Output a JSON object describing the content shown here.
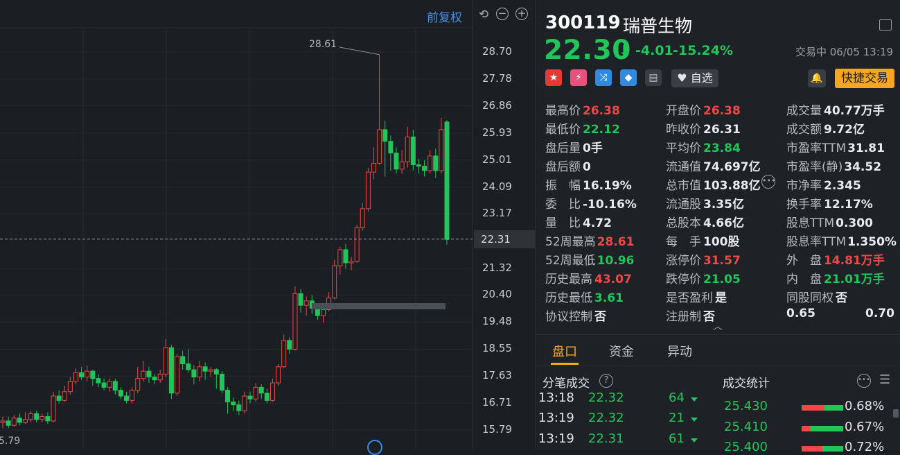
{
  "chart": {
    "restore_label": "前复权",
    "high_marker": "28.61",
    "low_marker": "5.79",
    "current_price_tag": "22.31",
    "y_ticks": [
      "28.70",
      "27.78",
      "26.86",
      "25.93",
      "25.01",
      "24.09",
      "23.17",
      "21.32",
      "20.40",
      "19.48",
      "18.55",
      "17.63",
      "16.71",
      "15.79"
    ],
    "up_color": "#f04848",
    "down_color": "#21c55a",
    "candles": [
      {
        "o": 16.05,
        "c": 16.1,
        "h": 16.25,
        "l": 15.85
      },
      {
        "o": 16.1,
        "c": 15.95,
        "h": 16.25,
        "l": 15.85
      },
      {
        "o": 15.95,
        "c": 16.2,
        "h": 16.3,
        "l": 15.9
      },
      {
        "o": 16.2,
        "c": 16.05,
        "h": 16.35,
        "l": 15.95
      },
      {
        "o": 16.05,
        "c": 16.15,
        "h": 16.4,
        "l": 16.0
      },
      {
        "o": 16.15,
        "c": 16.35,
        "h": 16.45,
        "l": 16.05
      },
      {
        "o": 16.35,
        "c": 16.15,
        "h": 16.45,
        "l": 16.05
      },
      {
        "o": 16.15,
        "c": 16.25,
        "h": 16.35,
        "l": 16.05
      },
      {
        "o": 16.25,
        "c": 16.1,
        "h": 16.4,
        "l": 16.0
      },
      {
        "o": 16.1,
        "c": 16.95,
        "h": 17.1,
        "l": 16.05
      },
      {
        "o": 16.95,
        "c": 16.8,
        "h": 17.15,
        "l": 16.7
      },
      {
        "o": 16.8,
        "c": 17.1,
        "h": 17.3,
        "l": 16.75
      },
      {
        "o": 17.1,
        "c": 17.45,
        "h": 17.6,
        "l": 17.0
      },
      {
        "o": 17.45,
        "c": 17.75,
        "h": 17.9,
        "l": 17.35
      },
      {
        "o": 17.75,
        "c": 17.6,
        "h": 17.95,
        "l": 17.5
      },
      {
        "o": 17.6,
        "c": 17.8,
        "h": 18.0,
        "l": 17.45
      },
      {
        "o": 17.8,
        "c": 17.55,
        "h": 17.85,
        "l": 17.3
      },
      {
        "o": 17.55,
        "c": 17.4,
        "h": 17.7,
        "l": 17.25
      },
      {
        "o": 17.4,
        "c": 17.25,
        "h": 17.55,
        "l": 17.15
      },
      {
        "o": 17.25,
        "c": 17.45,
        "h": 17.55,
        "l": 17.1
      },
      {
        "o": 17.45,
        "c": 17.15,
        "h": 17.55,
        "l": 17.0
      },
      {
        "o": 17.15,
        "c": 16.95,
        "h": 17.25,
        "l": 16.85
      },
      {
        "o": 16.95,
        "c": 16.8,
        "h": 17.1,
        "l": 16.7
      },
      {
        "o": 16.8,
        "c": 17.15,
        "h": 17.25,
        "l": 16.7
      },
      {
        "o": 17.15,
        "c": 17.55,
        "h": 17.95,
        "l": 17.05
      },
      {
        "o": 17.55,
        "c": 17.8,
        "h": 18.15,
        "l": 17.45
      },
      {
        "o": 17.8,
        "c": 17.6,
        "h": 17.95,
        "l": 17.4
      },
      {
        "o": 17.6,
        "c": 17.5,
        "h": 17.7,
        "l": 17.35
      },
      {
        "o": 17.5,
        "c": 17.7,
        "h": 17.85,
        "l": 17.4
      },
      {
        "o": 17.7,
        "c": 18.6,
        "h": 18.9,
        "l": 17.6
      },
      {
        "o": 18.6,
        "c": 17.05,
        "h": 18.7,
        "l": 16.85
      },
      {
        "o": 17.05,
        "c": 18.3,
        "h": 18.4,
        "l": 16.95
      },
      {
        "o": 18.3,
        "c": 18.05,
        "h": 18.5,
        "l": 17.85
      },
      {
        "o": 18.05,
        "c": 17.85,
        "h": 18.55,
        "l": 17.75
      },
      {
        "o": 17.85,
        "c": 17.6,
        "h": 18.0,
        "l": 17.35
      },
      {
        "o": 17.6,
        "c": 17.95,
        "h": 18.15,
        "l": 17.45
      },
      {
        "o": 17.95,
        "c": 17.8,
        "h": 18.1,
        "l": 17.5
      },
      {
        "o": 17.8,
        "c": 17.85,
        "h": 17.95,
        "l": 17.6
      },
      {
        "o": 17.85,
        "c": 17.7,
        "h": 17.9,
        "l": 17.2
      },
      {
        "o": 17.7,
        "c": 17.15,
        "h": 17.8,
        "l": 17.05
      },
      {
        "o": 17.15,
        "c": 16.75,
        "h": 17.25,
        "l": 16.35
      },
      {
        "o": 16.75,
        "c": 16.65,
        "h": 16.9,
        "l": 16.45
      },
      {
        "o": 16.65,
        "c": 16.45,
        "h": 16.8,
        "l": 16.3
      },
      {
        "o": 16.45,
        "c": 16.95,
        "h": 17.1,
        "l": 16.35
      },
      {
        "o": 16.95,
        "c": 16.85,
        "h": 17.1,
        "l": 16.7
      },
      {
        "o": 16.85,
        "c": 17.25,
        "h": 17.4,
        "l": 16.75
      },
      {
        "o": 17.25,
        "c": 17.05,
        "h": 17.35,
        "l": 16.85
      },
      {
        "o": 17.05,
        "c": 16.8,
        "h": 17.2,
        "l": 16.7
      },
      {
        "o": 16.8,
        "c": 17.4,
        "h": 17.55,
        "l": 16.75
      },
      {
        "o": 17.4,
        "c": 17.95,
        "h": 18.05,
        "l": 17.3
      },
      {
        "o": 17.95,
        "c": 18.85,
        "h": 19.05,
        "l": 17.9
      },
      {
        "o": 18.85,
        "c": 18.55,
        "h": 18.95,
        "l": 18.4
      },
      {
        "o": 18.55,
        "c": 20.45,
        "h": 20.7,
        "l": 18.5
      },
      {
        "o": 20.45,
        "c": 20.05,
        "h": 20.6,
        "l": 19.8
      },
      {
        "o": 20.05,
        "c": 20.2,
        "h": 20.35,
        "l": 19.7
      },
      {
        "o": 20.2,
        "c": 19.95,
        "h": 20.4,
        "l": 19.75
      },
      {
        "o": 19.95,
        "c": 19.7,
        "h": 20.1,
        "l": 19.55
      },
      {
        "o": 19.7,
        "c": 19.9,
        "h": 20.05,
        "l": 19.45
      },
      {
        "o": 19.9,
        "c": 20.3,
        "h": 20.5,
        "l": 19.85
      },
      {
        "o": 20.3,
        "c": 21.4,
        "h": 21.6,
        "l": 20.25
      },
      {
        "o": 21.4,
        "c": 21.95,
        "h": 22.05,
        "l": 21.1
      },
      {
        "o": 21.95,
        "c": 21.5,
        "h": 22.15,
        "l": 21.3
      },
      {
        "o": 21.5,
        "c": 21.55,
        "h": 21.7,
        "l": 21.25
      },
      {
        "o": 21.55,
        "c": 22.7,
        "h": 22.8,
        "l": 21.5
      },
      {
        "o": 22.7,
        "c": 23.35,
        "h": 23.55,
        "l": 22.6
      },
      {
        "o": 23.35,
        "c": 24.6,
        "h": 24.75,
        "l": 23.25
      },
      {
        "o": 24.6,
        "c": 24.9,
        "h": 25.45,
        "l": 24.35
      },
      {
        "o": 24.9,
        "c": 26.05,
        "h": 28.61,
        "l": 24.85
      },
      {
        "o": 26.05,
        "c": 25.65,
        "h": 26.35,
        "l": 24.45
      },
      {
        "o": 25.65,
        "c": 25.25,
        "h": 25.85,
        "l": 24.65
      },
      {
        "o": 25.25,
        "c": 24.7,
        "h": 25.45,
        "l": 24.55
      },
      {
        "o": 24.7,
        "c": 24.95,
        "h": 25.35,
        "l": 24.55
      },
      {
        "o": 24.95,
        "c": 25.8,
        "h": 26.15,
        "l": 24.75
      },
      {
        "o": 25.8,
        "c": 24.85,
        "h": 26.05,
        "l": 24.65
      },
      {
        "o": 24.85,
        "c": 24.8,
        "h": 25.05,
        "l": 24.55
      },
      {
        "o": 24.8,
        "c": 24.65,
        "h": 25.0,
        "l": 24.45
      },
      {
        "o": 24.65,
        "c": 25.15,
        "h": 25.35,
        "l": 24.55
      },
      {
        "o": 25.15,
        "c": 24.65,
        "h": 25.4,
        "l": 24.4
      },
      {
        "o": 24.65,
        "c": 26.05,
        "h": 26.45,
        "l": 24.55
      },
      {
        "o": 26.31,
        "c": 22.3,
        "h": 26.38,
        "l": 22.12
      }
    ]
  },
  "header": {
    "code": "300119",
    "name": "瑞普生物",
    "price": "22.30",
    "change": "-4.01",
    "change_pct": "-15.24%",
    "status": "交易中 06/05 13:19",
    "watchlist_label": "自选",
    "quick_trade_label": "快捷交易"
  },
  "stats": [
    [
      {
        "label": "最高价",
        "value": "26.38",
        "tone": "up"
      },
      {
        "label": "开盘价",
        "value": "26.38",
        "tone": "up"
      },
      {
        "label": "成交量",
        "value": "40.77万手",
        "tone": "val"
      }
    ],
    [
      {
        "label": "最低价",
        "value": "22.12",
        "tone": "down"
      },
      {
        "label": "昨收价",
        "value": "26.31",
        "tone": "val"
      },
      {
        "label": "成交额",
        "value": "9.72亿",
        "tone": "val"
      }
    ],
    [
      {
        "label": "盘后量",
        "value": "0手",
        "tone": "val"
      },
      {
        "label": "平均价",
        "value": "23.84",
        "tone": "down"
      },
      {
        "label": "市盈率TTM",
        "value": "31.81",
        "tone": "val"
      }
    ],
    [
      {
        "label": "盘后额",
        "value": "0",
        "tone": "val"
      },
      {
        "label": "流通值",
        "value": "74.697亿",
        "tone": "val"
      },
      {
        "label": "市盈率(静)",
        "value": "34.52",
        "tone": "val"
      }
    ],
    [
      {
        "label": "振　幅",
        "value": "16.19%",
        "tone": "val"
      },
      {
        "label": "总市值",
        "value": "103.88亿",
        "tone": "val"
      },
      {
        "label": "市净率",
        "value": "2.345",
        "tone": "val"
      }
    ],
    [
      {
        "label": "委　比",
        "value": "-10.16%",
        "tone": "val"
      },
      {
        "label": "流通股",
        "value": "3.35亿",
        "tone": "val"
      },
      {
        "label": "换手率",
        "value": "12.17%",
        "tone": "val"
      }
    ],
    [
      {
        "label": "量　比",
        "value": "4.72",
        "tone": "val"
      },
      {
        "label": "总股本",
        "value": "4.66亿",
        "tone": "val"
      },
      {
        "label": "股息TTM",
        "value": "0.300",
        "tone": "val"
      }
    ],
    [
      {
        "label": "52周最高",
        "value": "28.61",
        "tone": "up"
      },
      {
        "label": "每　手",
        "value": "100股",
        "tone": "val"
      },
      {
        "label": "股息率TTM",
        "value": "1.350%",
        "tone": "val"
      }
    ],
    [
      {
        "label": "52周最低",
        "value": "10.96",
        "tone": "down"
      },
      {
        "label": "涨停价",
        "value": "31.57",
        "tone": "up"
      },
      {
        "label": "外　盘",
        "value": "14.81万手",
        "tone": "up"
      }
    ],
    [
      {
        "label": "历史最高",
        "value": "43.07",
        "tone": "up"
      },
      {
        "label": "跌停价",
        "value": "21.05",
        "tone": "down"
      },
      {
        "label": "内　盘",
        "value": "21.01万手",
        "tone": "down"
      }
    ],
    [
      {
        "label": "历史最低",
        "value": "3.61",
        "tone": "down"
      },
      {
        "label": "是否盈利",
        "value": "是",
        "tone": "val"
      },
      {
        "label": "同股同权",
        "value": "否",
        "tone": "val"
      }
    ],
    [
      {
        "label": "协议控制",
        "value": "否",
        "tone": "val"
      },
      {
        "label": "注册制",
        "value": "否",
        "tone": "val"
      },
      {
        "label": "0.65",
        "value": "0.70",
        "tone": "val"
      }
    ]
  ],
  "tabs": [
    "盘口",
    "资金",
    "异动"
  ],
  "ticks_title": "分笔成交",
  "stats_title": "成交统计",
  "ticks": [
    {
      "time": "13:18",
      "price": "22.32",
      "vol": "64"
    },
    {
      "time": "13:19",
      "price": "22.32",
      "vol": "21"
    },
    {
      "time": "13:19",
      "price": "22.31",
      "vol": "61"
    }
  ],
  "price_stats": [
    {
      "price": "25.430",
      "pct": "0.68%",
      "red": 0.55
    },
    {
      "price": "25.410",
      "pct": "0.67%",
      "red": 0.2
    },
    {
      "price": "25.400",
      "pct": "0.72%",
      "red": 0.5
    }
  ]
}
